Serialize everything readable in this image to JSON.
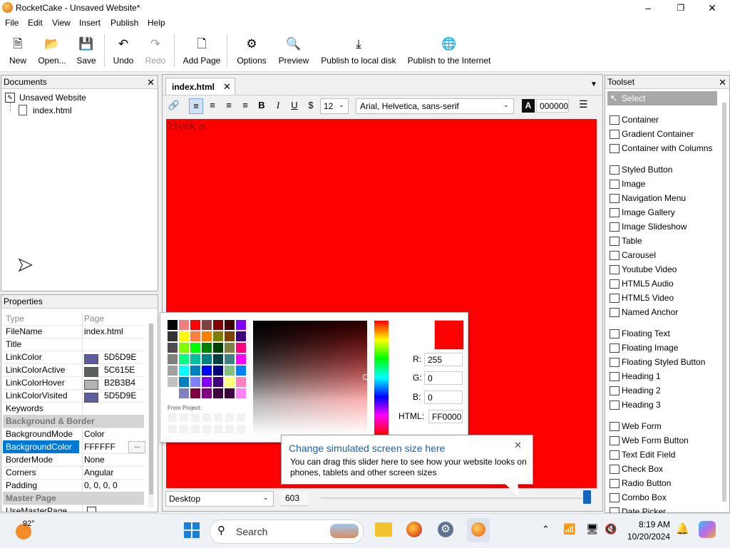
{
  "window": {
    "title": "RocketCake - Unsaved Website*"
  },
  "menu": [
    "File",
    "Edit",
    "View",
    "Insert",
    "Publish",
    "Help"
  ],
  "toolbar": {
    "new": "New",
    "open": "Open...",
    "save": "Save",
    "undo": "Undo",
    "redo": "Redo",
    "add_page": "Add Page",
    "options": "Options",
    "preview": "Preview",
    "publish_local": "Publish to local disk",
    "publish_internet": "Publish to the Internet"
  },
  "documents": {
    "title": "Documents",
    "root": "Unsaved Website",
    "file": "index.html"
  },
  "properties": {
    "title": "Properties",
    "header": {
      "key": "Type",
      "value": "Page"
    },
    "rows": [
      {
        "key": "FileName",
        "value": "index.html"
      },
      {
        "key": "Title",
        "value": ""
      },
      {
        "key": "LinkColor",
        "value": "5D5D9E",
        "swatch": "#5d5d9e"
      },
      {
        "key": "LinkColorActive",
        "value": "5C615E",
        "swatch": "#5c615e"
      },
      {
        "key": "LinkColorHover",
        "value": "B2B3B4",
        "swatch": "#b2b3b4"
      },
      {
        "key": "LinkColorVisited",
        "value": "5D5D9E",
        "swatch": "#5d5d9e"
      },
      {
        "key": "Keywords",
        "value": ""
      }
    ],
    "section_bg": "Background & Border",
    "rows2": [
      {
        "key": "BackgroundMode",
        "value": "Color"
      },
      {
        "key": "BackgroundColor",
        "value": "FFFFFF",
        "button": "..."
      },
      {
        "key": "BorderMode",
        "value": "None"
      },
      {
        "key": "Corners",
        "value": "Angular"
      },
      {
        "key": "Padding",
        "value": "0, 0, 0, 0"
      }
    ],
    "section_master": "Master Page",
    "row_last": {
      "key": "UseMasterPage",
      "value": ""
    }
  },
  "editor": {
    "tab": "index.html",
    "font_size": "12",
    "font_family": "Arial, Helvetica, sans-serif",
    "text_color_label": "A",
    "text_color_value": "000000",
    "canvas_text": "21vek is",
    "canvas_color": "#ff0000",
    "device": "Desktop",
    "width_value": "603"
  },
  "color_picker": {
    "from_project": "From Project:",
    "r_label": "R:",
    "g_label": "G:",
    "b_label": "B:",
    "html_label": "HTML:",
    "r": "255",
    "g": "0",
    "b": "0",
    "html": "FF0000",
    "selected": "#ff0000",
    "palette": [
      "#000000",
      "#f08080",
      "#ff0000",
      "#804040",
      "#800000",
      "#400000",
      "#8000ff",
      "#333333",
      "#ffff00",
      "#ff8040",
      "#ff8000",
      "#808000",
      "#804000",
      "#400080",
      "#4d4d4d",
      "#80ff00",
      "#00ff00",
      "#008000",
      "#004000",
      "#808040",
      "#ff0080",
      "#808080",
      "#00ff80",
      "#00c0a0",
      "#008080",
      "#004040",
      "#408080",
      "#ff00ff",
      "#a0a0a0",
      "#00ffff",
      "#0080c0",
      "#0000ff",
      "#000080",
      "#80c080",
      "#0080ff",
      "#c0c0c0",
      "#0080c0",
      "#8080ff",
      "#8000ff",
      "#400080",
      "#ffff80",
      "#ff80c0",
      "#ffffff",
      "#8080c0",
      "#800040",
      "#800080",
      "#400040",
      "#400040",
      "#ff80ff"
    ]
  },
  "tooltip": {
    "title": "Change simulated screen size here",
    "body": "You can drag this slider here to see how your website looks on phones, tablets and other screen sizes"
  },
  "toolset": {
    "title": "Toolset",
    "groups": [
      [
        {
          "label": "Select",
          "icon": "cursor-icon"
        }
      ],
      [
        {
          "label": "Container",
          "icon": "container-icon"
        },
        {
          "label": "Gradient Container",
          "icon": "gradient-container-icon"
        },
        {
          "label": "Container with Columns",
          "icon": "columns-icon"
        }
      ],
      [
        {
          "label": "Styled Button",
          "icon": "styled-button-icon"
        },
        {
          "label": "Image",
          "icon": "image-icon"
        },
        {
          "label": "Navigation Menu",
          "icon": "navigation-menu-icon"
        },
        {
          "label": "Image Gallery",
          "icon": "image-gallery-icon"
        },
        {
          "label": "Image Slideshow",
          "icon": "image-slideshow-icon"
        },
        {
          "label": "Table",
          "icon": "table-icon"
        },
        {
          "label": "Carousel",
          "icon": "carousel-icon"
        },
        {
          "label": "Youtube Video",
          "icon": "youtube-icon"
        },
        {
          "label": "HTML5 Audio",
          "icon": "audio-icon"
        },
        {
          "label": "HTML5 Video",
          "icon": "video-icon"
        },
        {
          "label": "Named Anchor",
          "icon": "anchor-icon"
        }
      ],
      [
        {
          "label": "Floating Text",
          "icon": "floating-text-icon"
        },
        {
          "label": "Floating Image",
          "icon": "floating-image-icon"
        },
        {
          "label": "Floating Styled Button",
          "icon": "floating-button-icon"
        },
        {
          "label": "Heading 1",
          "icon": "heading1-icon"
        },
        {
          "label": "Heading 2",
          "icon": "heading2-icon"
        },
        {
          "label": "Heading 3",
          "icon": "heading3-icon"
        }
      ],
      [
        {
          "label": "Web Form",
          "icon": "web-form-icon"
        },
        {
          "label": "Web Form Button",
          "icon": "web-form-button-icon"
        },
        {
          "label": "Text Edit Field",
          "icon": "text-field-icon"
        },
        {
          "label": "Check Box",
          "icon": "checkbox-icon"
        },
        {
          "label": "Radio Button",
          "icon": "radio-icon"
        },
        {
          "label": "Combo Box",
          "icon": "combo-box-icon"
        },
        {
          "label": "Date Picker",
          "icon": "date-picker-icon"
        }
      ]
    ]
  },
  "taskbar": {
    "weather": "92°",
    "search": "Search",
    "time": "8:19 AM",
    "date": "10/20/2024"
  }
}
